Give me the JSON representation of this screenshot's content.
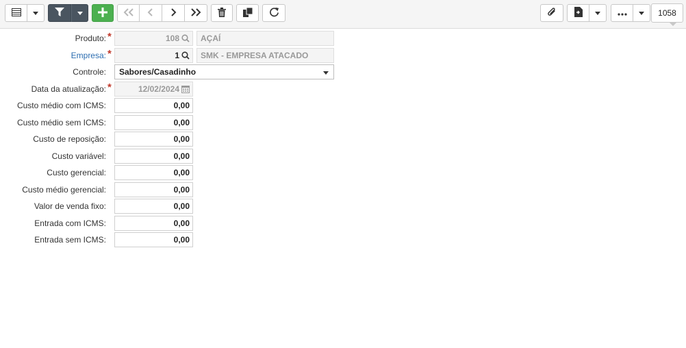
{
  "toolbar": {
    "record_count": "1058",
    "icons": [
      "grid-icon",
      "filter-icon",
      "plus-icon",
      "first-icon",
      "prev-icon",
      "next-icon",
      "last-icon",
      "trash-icon",
      "copy-icon",
      "refresh-icon",
      "paperclip-icon",
      "report-icon",
      "ellipsis-icon"
    ]
  },
  "form": {
    "produto": {
      "label": "Produto:",
      "code": "108",
      "description": "AÇAÍ"
    },
    "empresa": {
      "label": "Empresa:",
      "code": "1",
      "description": "SMK - EMPRESA ATACADO"
    },
    "controle": {
      "label": "Controle:",
      "value": "Sabores/Casadinho"
    },
    "data_atualizacao": {
      "label": "Data da atualização:",
      "value": "12/02/2024"
    },
    "costs": [
      {
        "label": "Custo médio com ICMS:",
        "value": "0,00"
      },
      {
        "label": "Custo médio sem ICMS:",
        "value": "0,00"
      },
      {
        "label": "Custo de reposição:",
        "value": "0,00"
      },
      {
        "label": "Custo variável:",
        "value": "0,00"
      },
      {
        "label": "Custo gerencial:",
        "value": "0,00"
      },
      {
        "label": "Custo médio gerencial:",
        "value": "0,00"
      },
      {
        "label": "Valor de venda fixo:",
        "value": "0,00"
      },
      {
        "label": "Entrada com ICMS:",
        "value": "0,00"
      },
      {
        "label": "Entrada sem ICMS:",
        "value": "0,00"
      }
    ]
  },
  "colors": {
    "accent_green": "#4cb050",
    "dark_button": "#4a5560",
    "link_blue": "#2a6cb0",
    "required_red": "#c0392b"
  }
}
